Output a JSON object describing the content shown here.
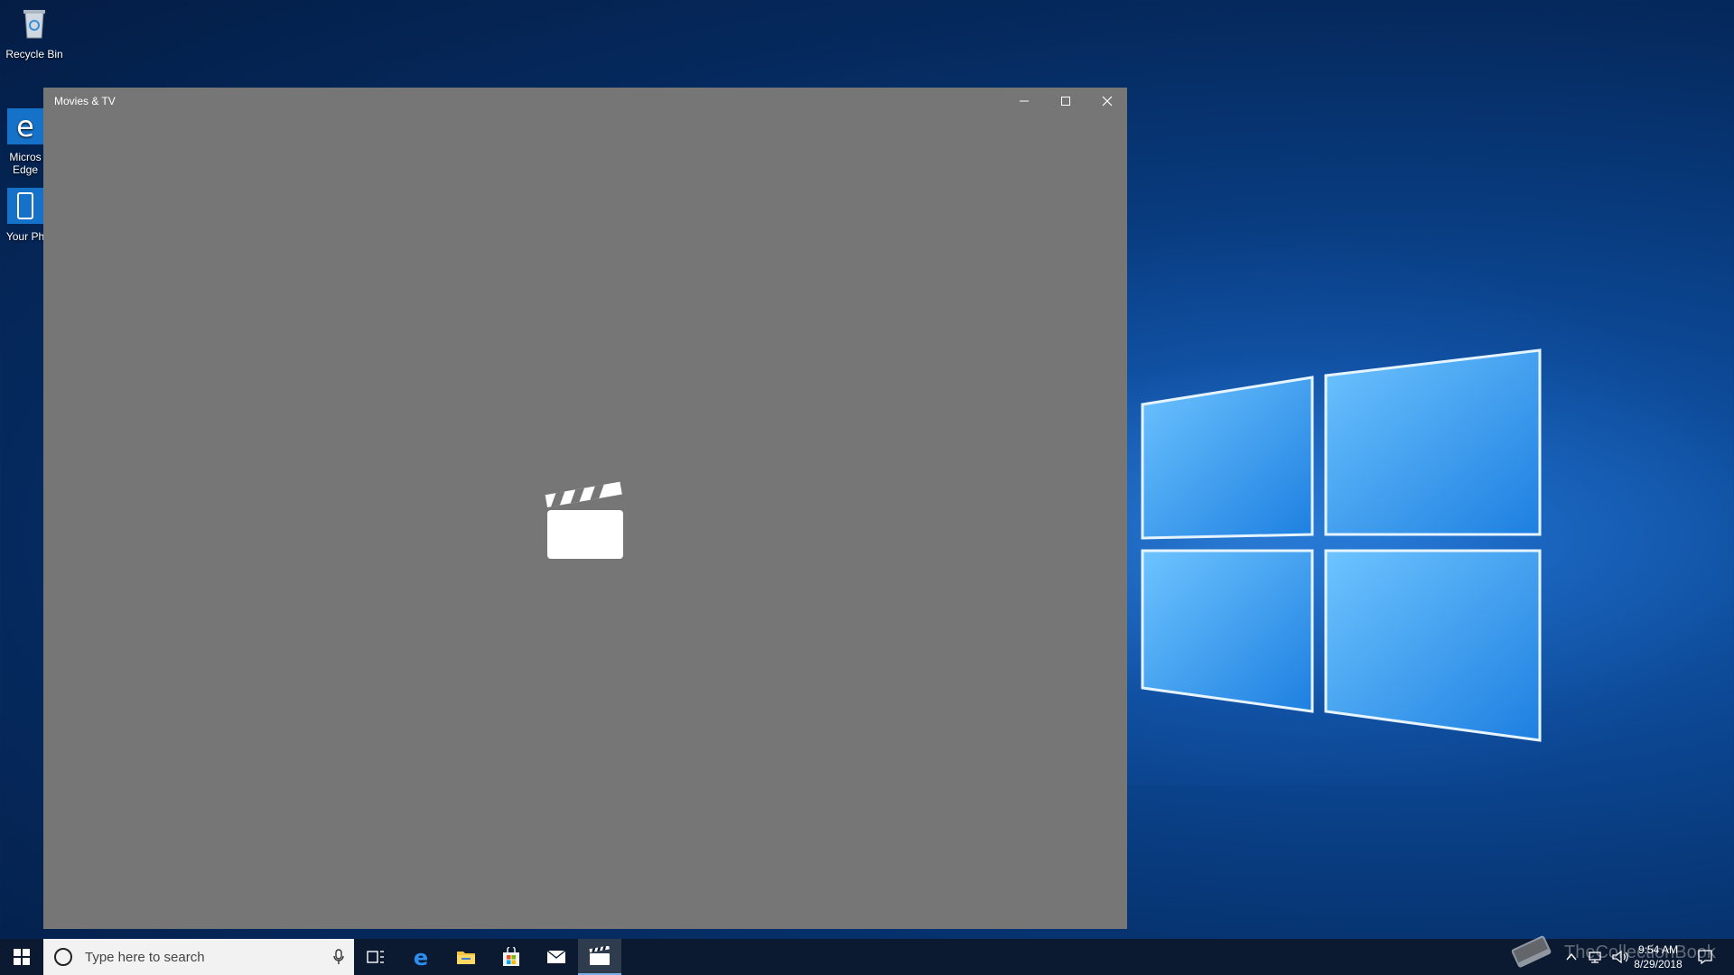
{
  "desktop": {
    "icons": [
      {
        "label": "Recycle Bin",
        "icon": "recycle-bin-icon"
      },
      {
        "label": "Micros\nEdge",
        "icon": "edge-icon"
      },
      {
        "label": "Your Ph",
        "icon": "your-phone-icon"
      }
    ]
  },
  "window": {
    "title": "Movies & TV",
    "background_color": "#767676",
    "splash_icon": "clapperboard-icon"
  },
  "taskbar": {
    "search_placeholder": "Type here to search",
    "apps": [
      {
        "name": "task-view",
        "icon": "task-view-icon"
      },
      {
        "name": "edge",
        "icon": "edge-icon"
      },
      {
        "name": "file-explorer",
        "icon": "folder-icon"
      },
      {
        "name": "store",
        "icon": "store-icon"
      },
      {
        "name": "mail",
        "icon": "mail-icon"
      },
      {
        "name": "movies-tv",
        "icon": "clapperboard-icon",
        "active": true
      }
    ],
    "clock": {
      "time": "9:54 AM",
      "date": "8/29/2018"
    }
  },
  "watermark": {
    "text": "TheCollectionBook"
  }
}
